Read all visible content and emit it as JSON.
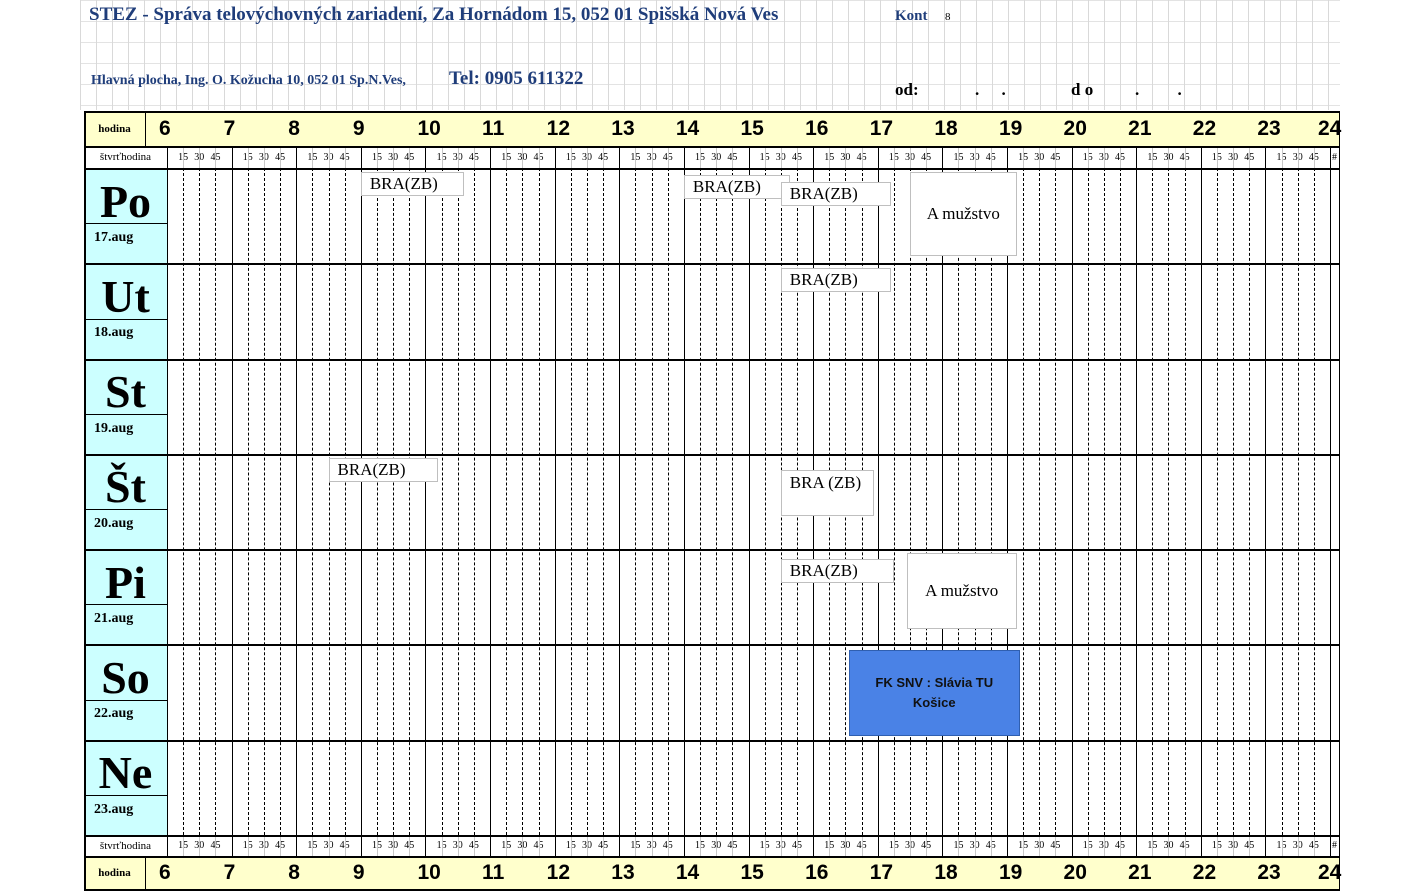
{
  "header": {
    "title": "STEZ - Správa telovýchovných zariadení, Za Hornádom 15, 052 01 Spišská Nová Ves",
    "kontakt": "Kont",
    "kontakt_tail": "8",
    "address": "Hlavná plocha, Ing. O. Kožucha 10, 052 01 Sp.N.Ves,",
    "tel": "Tel: 0905 611322",
    "od_label": "od:",
    "od_dots": ". .",
    "do_label": "d o",
    "do_dots": ". ."
  },
  "table": {
    "hour_label": "hodina",
    "quarter_label": "štvrťhodina",
    "hours": [
      "6",
      "7",
      "8",
      "9",
      "10",
      "11",
      "12",
      "13",
      "14",
      "15",
      "16",
      "17",
      "18",
      "19",
      "20",
      "21",
      "22",
      "23",
      "24"
    ],
    "quarters": [
      "15",
      "30",
      "45"
    ],
    "last_quarter": "#",
    "days": [
      {
        "abbr": "Po",
        "date": "17.aug"
      },
      {
        "abbr": "Ut",
        "date": "18.aug"
      },
      {
        "abbr": "St",
        "date": "19.aug"
      },
      {
        "abbr": "Št",
        "date": "20.aug"
      },
      {
        "abbr": "Pi",
        "date": "21.aug"
      },
      {
        "abbr": "So",
        "date": "22.aug"
      },
      {
        "abbr": "Ne",
        "date": "23.aug"
      }
    ]
  },
  "bookings": [
    {
      "day": 0,
      "start": 9.0,
      "end": 10.6,
      "text": "BRA(ZB)",
      "kind": "small"
    },
    {
      "day": 0,
      "start": 14.0,
      "end": 15.65,
      "text": "BRA(ZB)",
      "kind": "small",
      "off": 3
    },
    {
      "day": 0,
      "start": 15.5,
      "end": 17.2,
      "text": "BRA(ZB)",
      "kind": "small",
      "off": 10
    },
    {
      "day": 0,
      "start": 17.5,
      "end": 19.15,
      "text": "A mužstvo",
      "kind": "big"
    },
    {
      "day": 1,
      "start": 15.5,
      "end": 17.2,
      "text": "BRA(ZB)",
      "kind": "small",
      "off": 1
    },
    {
      "day": 3,
      "start": 8.5,
      "end": 10.2,
      "text": "BRA(ZB)",
      "kind": "small"
    },
    {
      "day": 3,
      "start": 15.5,
      "end": 16.95,
      "text": "BRA (ZB)",
      "kind": "two"
    },
    {
      "day": 4,
      "start": 15.5,
      "end": 17.25,
      "text": "BRA(ZB)",
      "kind": "small",
      "off": 6
    },
    {
      "day": 4,
      "start": 17.45,
      "end": 19.15,
      "text": "A mužstvo",
      "kind": "big2"
    },
    {
      "day": 5,
      "start": 16.55,
      "end": 19.2,
      "text": "FK SNV : Slávia TU Košice",
      "kind": "match"
    }
  ],
  "colors": {
    "day_cell": "#ccffff",
    "hour_band": "#ffffcc",
    "match_fill": "#4a82e6",
    "header_text": "#1f3d7a"
  }
}
